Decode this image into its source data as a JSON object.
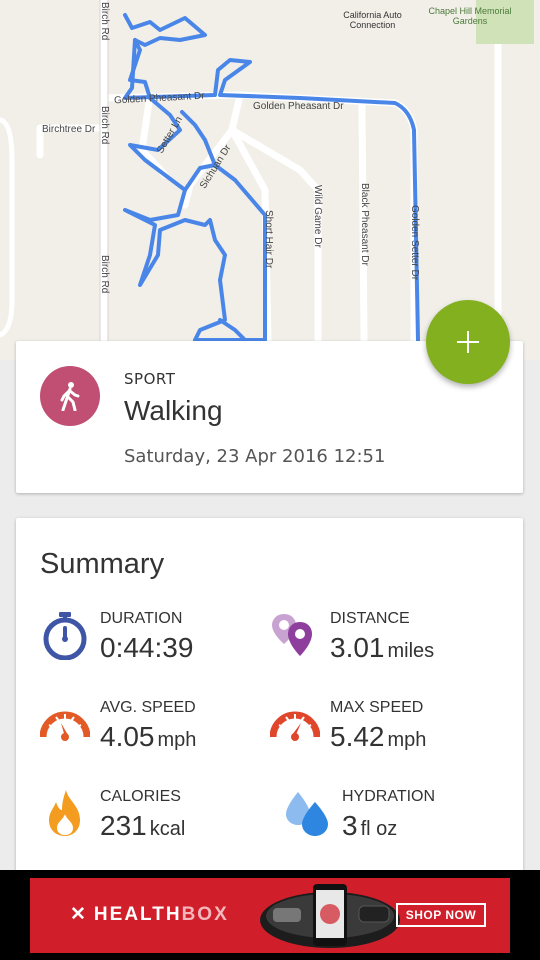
{
  "map": {
    "roads": {
      "birch_rd_top": "Birch Rd",
      "birch_rd_mid": "Birch Rd",
      "birch_rd_bottom": "Birch Rd",
      "birchtree_dr": "Birchtree Dr",
      "golden_pheasant_dr_left": "Golden Pheasant Dr",
      "golden_pheasant_dr_right": "Golden Pheasant Dr",
      "setter_ln": "Setter Ln",
      "sichuan_dr": "Sichuan Dr",
      "short_hair_dr": "Short Hair Dr",
      "wild_game_dr": "Wild Game Dr",
      "black_pheasant_dr": "Black Pheasant Dr",
      "golden_setter_dr": "Golden Setter Dr"
    },
    "pois": {
      "california_auto_connection": "California Auto Connection",
      "chapel_hill_memorial_gardens": "Chapel Hill Memorial Gardens"
    },
    "route_color": "#4a86e8"
  },
  "fab": {
    "icon": "plus-icon",
    "color": "#83b01f"
  },
  "sport_card": {
    "label": "SPORT",
    "sport": "Walking",
    "datetime": "Saturday, 23 Apr 2016 12:51",
    "avatar_color": "#c04f73",
    "avatar_icon": "walking-person-icon"
  },
  "summary": {
    "title": "Summary",
    "metrics": {
      "duration": {
        "label": "DURATION",
        "value": "0:44:39",
        "unit": "",
        "icon": "stopwatch-icon",
        "color": "#3f55a6"
      },
      "distance": {
        "label": "DISTANCE",
        "value": "3.01",
        "unit": "miles",
        "icon": "location-pins-icon",
        "color": "#9c4fa8"
      },
      "avg_speed": {
        "label": "AVG. SPEED",
        "value": "4.05",
        "unit": "mph",
        "icon": "speedometer-icon",
        "color": "#e25a25"
      },
      "max_speed": {
        "label": "MAX SPEED",
        "value": "5.42",
        "unit": "mph",
        "icon": "speedometer-icon",
        "color": "#e0462a"
      },
      "calories": {
        "label": "CALORIES",
        "value": "231",
        "unit": "kcal",
        "icon": "flame-icon",
        "color": "#f39c1f"
      },
      "hydration": {
        "label": "HYDRATION",
        "value": "3",
        "unit": "fl oz",
        "icon": "water-drops-icon",
        "color": "#3d8fe0"
      }
    }
  },
  "ad": {
    "brand_main": "HEALTH",
    "brand_sub": "BOX",
    "cta": "SHOP NOW",
    "background_color": "#d01f2b"
  }
}
